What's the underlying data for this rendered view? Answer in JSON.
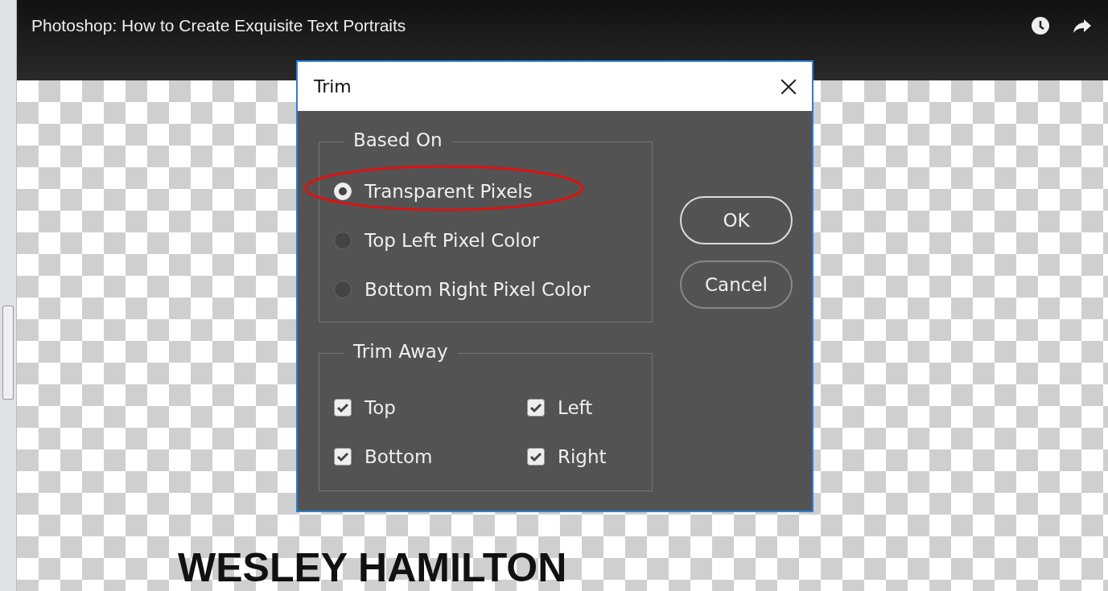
{
  "video": {
    "title": "Photoshop: How to Create Exquisite Text Portraits",
    "caption": "WESLEY HAMILTON"
  },
  "dialog": {
    "title": "Trim",
    "based_on": {
      "label": "Based On",
      "options": [
        {
          "label": "Transparent Pixels",
          "selected": true
        },
        {
          "label": "Top Left Pixel Color",
          "selected": false
        },
        {
          "label": "Bottom Right Pixel Color",
          "selected": false
        }
      ]
    },
    "trim_away": {
      "label": "Trim Away",
      "options": [
        {
          "label": "Top",
          "checked": true
        },
        {
          "label": "Left",
          "checked": true
        },
        {
          "label": "Bottom",
          "checked": true
        },
        {
          "label": "Right",
          "checked": true
        }
      ]
    },
    "buttons": [
      {
        "label": "OK",
        "kind": "default"
      },
      {
        "label": "Cancel",
        "kind": "normal"
      }
    ]
  }
}
